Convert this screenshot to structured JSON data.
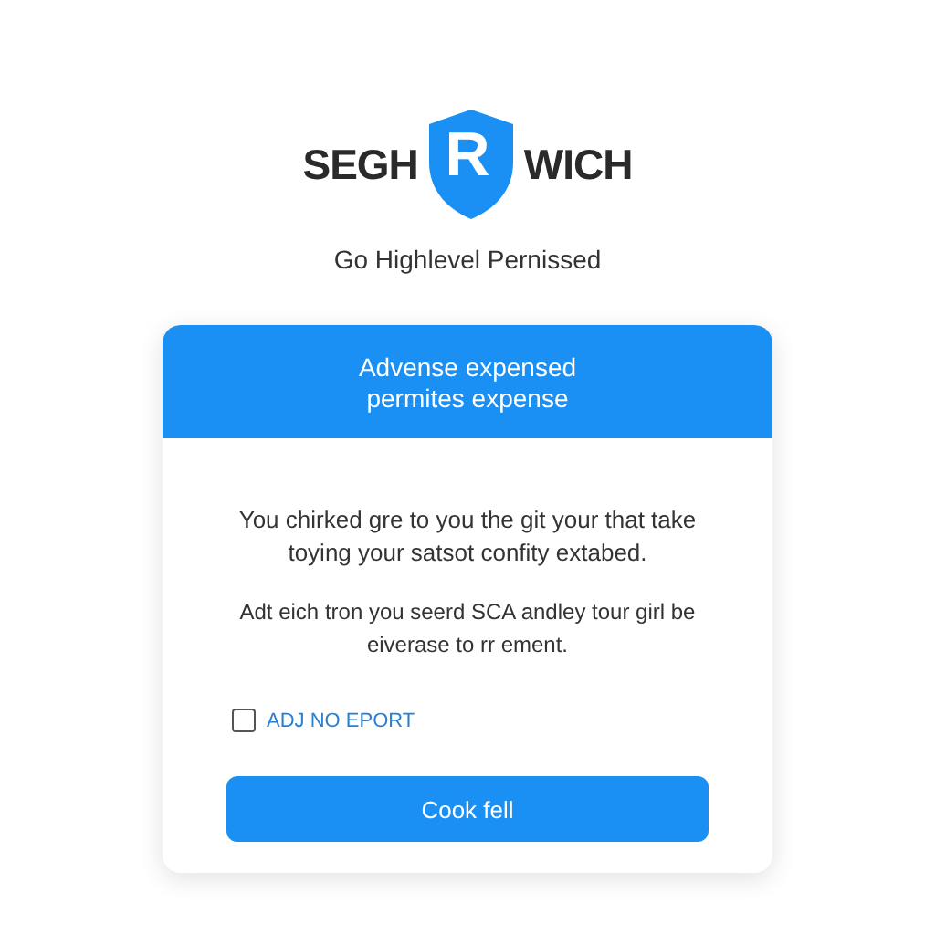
{
  "logo": {
    "left": "SEGH",
    "badge": "R",
    "right": "WICH"
  },
  "subtitle": "Go Highlevel Pernissed",
  "card": {
    "header": [
      "Advense expensed",
      "permites expense"
    ],
    "paragraphs": [
      "You chirked gre to you the git your that take toying your satsot confity extabed.",
      "Adt eich tron you seerd SCA andley tour girl be eiverase to rr ement."
    ],
    "checkbox": {
      "label": "ADJ NO EPORT",
      "checked": false
    },
    "button": "Cook fell"
  }
}
